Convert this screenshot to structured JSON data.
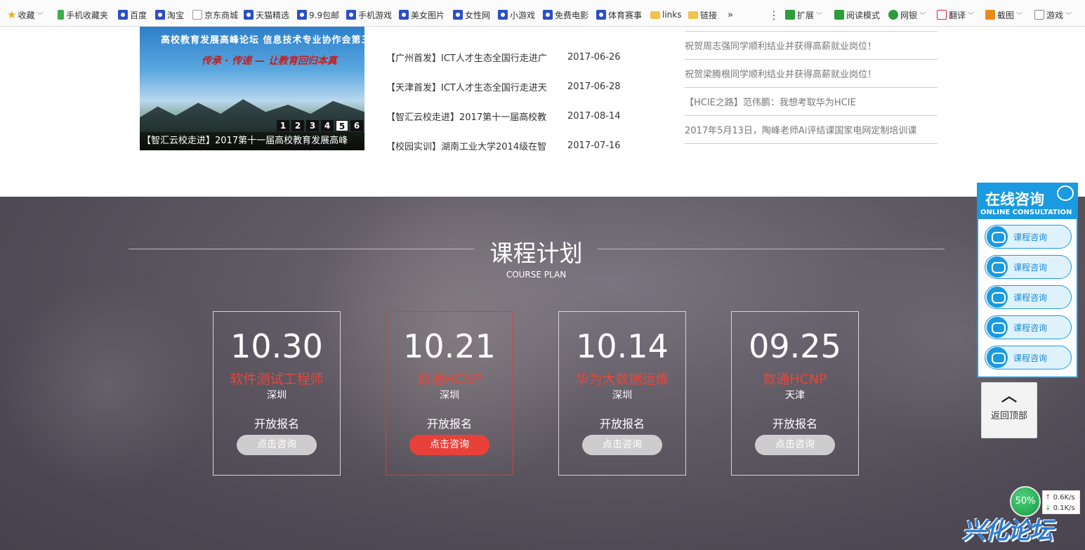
{
  "bookmarks": [
    {
      "label": "收藏",
      "icon": "star-icon"
    },
    {
      "label": "手机收藏夹",
      "icon": "phone-icon"
    },
    {
      "label": "百度",
      "icon": "paw-icon"
    },
    {
      "label": "淘宝",
      "icon": "paw-icon"
    },
    {
      "label": "京东商城",
      "icon": "page-icon"
    },
    {
      "label": "天猫精选",
      "icon": "paw-icon"
    },
    {
      "label": "9.9包邮",
      "icon": "paw-icon"
    },
    {
      "label": "手机游戏",
      "icon": "paw-icon"
    },
    {
      "label": "美女图片",
      "icon": "paw-icon"
    },
    {
      "label": "女性网",
      "icon": "paw-icon"
    },
    {
      "label": "小游戏",
      "icon": "paw-icon"
    },
    {
      "label": "免费电影",
      "icon": "paw-icon"
    },
    {
      "label": "体育赛事",
      "icon": "paw-icon"
    },
    {
      "label": "links",
      "icon": "folder-icon"
    },
    {
      "label": "链接",
      "icon": "folder-icon"
    }
  ],
  "more_label": "»",
  "toolbar": {
    "extend": "扩展",
    "read_mode": "阅读模式",
    "bank": "网银",
    "translate": "翻译",
    "screenshot": "截图",
    "game": "游戏"
  },
  "banner": {
    "line1": "高校教育发展高峰论坛    信息技术专业协作会第三次产教融合论坛",
    "line2": "传承 · 传递 — 让教育回归本真",
    "pages": [
      "1",
      "2",
      "3",
      "4",
      "5",
      "6"
    ],
    "active_page": "5",
    "caption": "【智汇云校走进】2017第十一届高校教育发展高峰"
  },
  "news": [
    {
      "title": "【广州首发】ICT人才生态全国行走进广",
      "date": "2017-06-26"
    },
    {
      "title": "【天津首发】ICT人才生态全国行走进天",
      "date": "2017-06-28"
    },
    {
      "title": "【智汇云校走进】2017第十一届高校教",
      "date": "2017-08-14"
    },
    {
      "title": "【校园实训】湖南工业大学2014级在智",
      "date": "2017-07-16"
    }
  ],
  "notices": [
    "祝贺周志强同学顺利结业并获得高薪就业岗位！",
    "祝贺梁腾根同学顺利结业并获得高薪就业岗位！",
    "【HCIE之路】范伟鹏：我想考取华为HCIE",
    "2017年5月13日，陶峰老师Ai评结课国家电网定制培训课"
  ],
  "course_plan": {
    "title": "课程计划",
    "subtitle": "COURSE PLAN",
    "courses": [
      {
        "date": "10.30",
        "name": "软件测试工程师",
        "city": "深圳",
        "status": "开放报名",
        "button": "点击咨询"
      },
      {
        "date": "10.21",
        "name": "数通HCNP",
        "city": "深圳",
        "status": "开放报名",
        "button": "点击咨询"
      },
      {
        "date": "10.14",
        "name": "华为大数据运维",
        "city": "深圳",
        "status": "开放报名",
        "button": "点击咨询"
      },
      {
        "date": "09.25",
        "name": "数通HCNP",
        "city": "天津",
        "status": "开放报名",
        "button": "点击咨询"
      }
    ]
  },
  "consult": {
    "title": "在线咨询",
    "subtitle": "ONLINE CONSULTATION",
    "buttons": [
      "课程咨询",
      "课程咨询",
      "课程咨询",
      "课程咨询",
      "课程咨询"
    ]
  },
  "back_to_top": {
    "arrow": "︿",
    "label": "返回顶部"
  },
  "speed": {
    "percent": "50%",
    "up": "0.6K/s",
    "down": "0.1K/s",
    "up_arrow": "↑",
    "down_arrow": "↓"
  },
  "logo_text": "兴化论坛",
  "colors": {
    "accent_red": "#e8413a",
    "consult_blue": "#1a9ae0"
  }
}
